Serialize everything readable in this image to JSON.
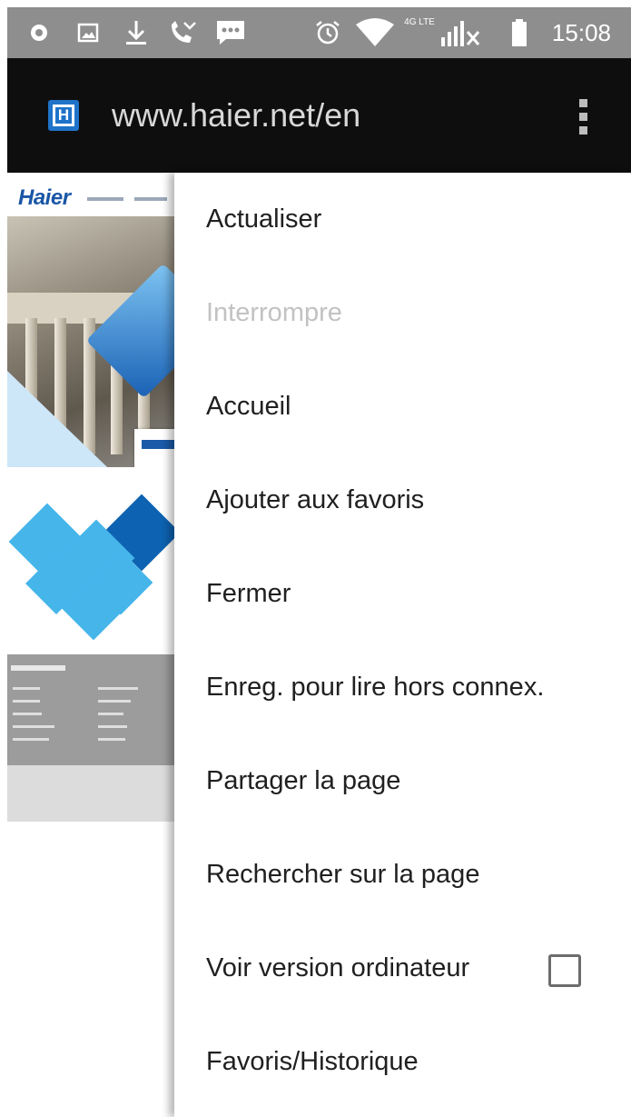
{
  "status_bar": {
    "time": "15:08",
    "network_label": "4G LTE",
    "icons": [
      "notification-dot-icon",
      "image-icon",
      "download-icon",
      "missed-call-icon",
      "message-icon",
      "alarm-icon",
      "wifi-icon",
      "signal-icon",
      "battery-icon"
    ]
  },
  "toolbar": {
    "site_icon_letter": "H",
    "url": "www.haier.net/en",
    "overflow_icon": "more-vert-icon"
  },
  "webpage": {
    "logo_text": "Haier"
  },
  "menu": {
    "items": [
      {
        "label": "Actualiser",
        "enabled": true
      },
      {
        "label": "Interrompre",
        "enabled": false
      },
      {
        "label": "Accueil",
        "enabled": true
      },
      {
        "label": "Ajouter aux favoris",
        "enabled": true
      },
      {
        "label": "Fermer",
        "enabled": true
      },
      {
        "label": "Enreg. pour lire hors connex.",
        "enabled": true
      },
      {
        "label": "Partager la page",
        "enabled": true
      },
      {
        "label": "Rechercher sur la page",
        "enabled": true
      },
      {
        "label": "Voir version ordinateur",
        "enabled": true,
        "checkbox": false
      },
      {
        "label": "Favoris/Historique",
        "enabled": true
      }
    ]
  },
  "colors": {
    "status_bar": "#8e8e8e",
    "toolbar": "#0e0e0e",
    "brand_blue": "#1a56a6",
    "menu_text": "#202020",
    "menu_text_disabled": "#c2c2c2"
  }
}
